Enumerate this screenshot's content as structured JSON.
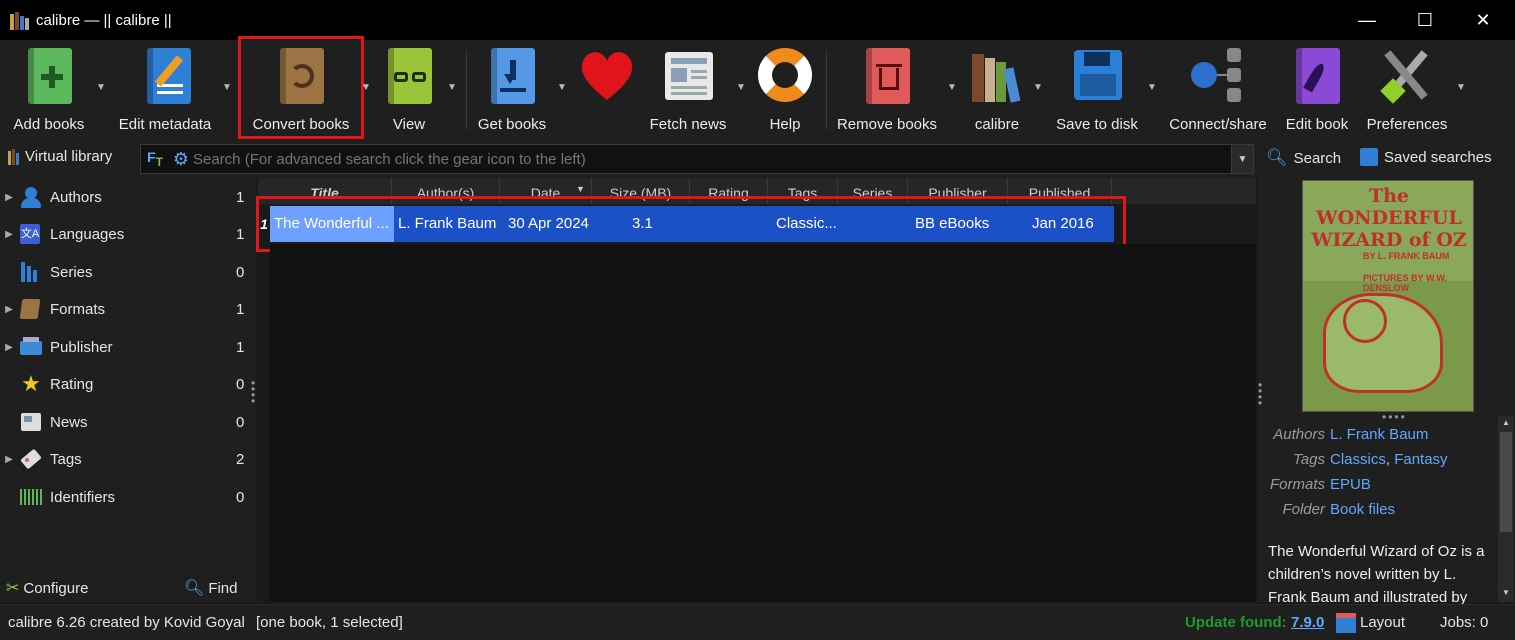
{
  "window": {
    "title": "calibre — || calibre ||",
    "minimize": "—",
    "maximize": "☐",
    "close": "✕"
  },
  "toolbar": {
    "add_books": "Add books",
    "edit_metadata": "Edit metadata",
    "convert_books": "Convert books",
    "view": "View",
    "get_books": "Get books",
    "fetch_news": "Fetch news",
    "help": "Help",
    "remove_books": "Remove books",
    "calibre": "calibre",
    "save_to_disk": "Save to disk",
    "connect_share": "Connect/share",
    "edit_book": "Edit book",
    "preferences": "Preferences"
  },
  "searchbar": {
    "virtual_library": "Virtual library",
    "placeholder": "Search (For advanced search click the gear icon to the left)",
    "search_label": "Search",
    "saved_searches_label": "Saved searches"
  },
  "tag_browser": {
    "items": [
      {
        "name": "Authors",
        "count": "1",
        "expandable": true,
        "icon": "person-icon"
      },
      {
        "name": "Languages",
        "count": "1",
        "expandable": true,
        "icon": "language-icon"
      },
      {
        "name": "Series",
        "count": "0",
        "expandable": false,
        "icon": "series-icon"
      },
      {
        "name": "Formats",
        "count": "1",
        "expandable": true,
        "icon": "formats-icon"
      },
      {
        "name": "Publisher",
        "count": "1",
        "expandable": true,
        "icon": "publisher-icon"
      },
      {
        "name": "Rating",
        "count": "0",
        "expandable": false,
        "icon": "star-icon"
      },
      {
        "name": "News",
        "count": "0",
        "expandable": false,
        "icon": "news-icon"
      },
      {
        "name": "Tags",
        "count": "2",
        "expandable": true,
        "icon": "tag-icon"
      },
      {
        "name": "Identifiers",
        "count": "0",
        "expandable": false,
        "icon": "barcode-icon"
      }
    ],
    "configure": "Configure",
    "find": "Find"
  },
  "book_list": {
    "columns": [
      "Title",
      "Author(s)",
      "Date",
      "Size (MB)",
      "Rating",
      "Tags",
      "Series",
      "Publisher",
      "Published"
    ],
    "rows": [
      {
        "num": "1",
        "title": "The Wonderful ...",
        "authors": "L. Frank Baum",
        "date": "30 Apr 2024",
        "size": "3.1",
        "rating": "",
        "tags": "Classic...",
        "series": "",
        "publisher": "BB eBooks",
        "published": "Jan 2016"
      }
    ]
  },
  "details": {
    "cover_title": "The WONDERFUL WIZARD of OZ",
    "cover_by": "BY L. FRANK BAUM",
    "cover_pictures": "PICTURES BY W.W. DENSLOW",
    "authors_key": "Authors",
    "authors_val": "L. Frank Baum",
    "tags_key": "Tags",
    "tag1": "Classics",
    "tag2": "Fantasy",
    "formats_key": "Formats",
    "formats_val": "EPUB",
    "folder_key": "Folder",
    "folder_val": "Book files",
    "description": "The Wonderful Wizard of Oz is a children’s novel written by L. Frank Baum and illustrated by"
  },
  "status": {
    "created_by": "calibre 6.26 created by Kovid Goyal",
    "selection": "[one book, 1 selected]",
    "update_label": "Update found:",
    "update_version": "7.9.0",
    "layout": "Layout",
    "jobs": "Jobs: 0"
  },
  "colors": {
    "accent_select": "#1b50c7",
    "highlight_box": "#e0161b",
    "link": "#5fa8ff",
    "update_green": "#1e9b2f"
  }
}
